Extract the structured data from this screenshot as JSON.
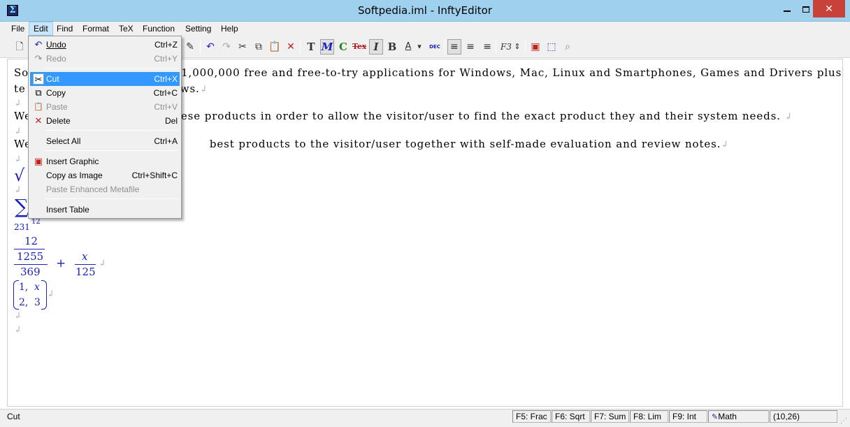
{
  "window": {
    "title": "Softpedia.iml - InftyEditor",
    "icon": "infty-editor-logo-icon",
    "app_icon_glyph": "Σ",
    "close_glyph": "✕"
  },
  "menubar": [
    "File",
    "Edit",
    "Find",
    "Format",
    "TeX",
    "Function",
    "Setting",
    "Help"
  ],
  "edit_menu": [
    {
      "label": "Undo",
      "shortcut": "Ctrl+Z",
      "icon": "↶"
    },
    {
      "label": "Redo",
      "shortcut": "Ctrl+Y",
      "icon": "↷"
    },
    {
      "label": "Cut",
      "shortcut": "Ctrl+X",
      "icon": "✂"
    },
    {
      "label": "Copy",
      "shortcut": "Ctrl+C",
      "icon": "⧉"
    },
    {
      "label": "Paste",
      "shortcut": "Ctrl+V",
      "icon": "📋"
    },
    {
      "label": "Delete",
      "shortcut": "Del",
      "icon": "✕"
    },
    {
      "label": "Select All",
      "shortcut": "Ctrl+A",
      "icon": ""
    },
    {
      "label": "Insert Graphic",
      "shortcut": "",
      "icon": "▣"
    },
    {
      "label": "Copy as Image",
      "shortcut": "Ctrl+Shift+C",
      "icon": ""
    },
    {
      "label": "Paste Enhanced Metafile",
      "shortcut": "",
      "icon": ""
    },
    {
      "label": "Insert Table",
      "shortcut": "",
      "icon": ""
    }
  ],
  "toolbar": {
    "icons": [
      "new-file-icon",
      "edit-graphic-icon",
      "undo-icon",
      "redo-icon",
      "cut-icon",
      "copy-icon",
      "paste-icon",
      "delete-icon",
      "text-mode-icon",
      "math-mode-icon",
      "chemistry-mode-icon",
      "tex-mode-icon",
      "italic-icon",
      "bold-icon",
      "font-color-icon",
      "font-color-dropdown-icon",
      "dec-icon",
      "align-left-icon",
      "align-center-icon",
      "align-right-icon",
      "function-key-icon",
      "spin-icon",
      "insert-graphic-icon",
      "copy-image-icon",
      "zoom-icon"
    ],
    "glyphs": {
      "text": "T",
      "math": "M",
      "chem": "C",
      "tex": "Tex",
      "italic": "I",
      "bold": "B",
      "font_color": "A",
      "dropdown": "▾",
      "dec": "DEC",
      "align_left": "≡",
      "align_center": "≡",
      "align_right": "≡",
      "function": "F3",
      "spin": "⇕",
      "graphic": "▣",
      "copy_image": "⬚",
      "zoom": "⌕",
      "new": "🗋",
      "edit_graphic": "✎",
      "undo": "↶",
      "redo": "↷",
      "cut": "✂",
      "copy": "⧉",
      "paste": "📋",
      "delete": "✕"
    }
  },
  "document": {
    "paragraph_mark": "↲",
    "lines": [
      {
        "pre": "So",
        "post": "1,000,000 free and free-to-try applications for Windows, Mac, Linux and Smartphones, Games and Drivers plus"
      },
      {
        "pre": " te",
        "post": "ws."
      },
      {
        "pre": "We",
        "post": "ese products in order to allow the visitor/user to find the exact product they and their system needs."
      },
      {
        "pre": "We",
        "post": "best products to the visitor/user together with self-made evaluation and review notes."
      }
    ],
    "math": {
      "sqrt_symbol": "√",
      "sum_symbol": "∑",
      "sum_lower": "231",
      "sum_upper": "12",
      "frac_num_top": "12",
      "frac_num_bottom": "1255",
      "frac_den": "369",
      "plus": "+",
      "frac2_num": "x",
      "frac2_den": "125",
      "matrix": [
        [
          "1,",
          "x"
        ],
        [
          "2,",
          "3"
        ]
      ]
    }
  },
  "statusbar": {
    "text": "Cut",
    "panels": [
      "F5:  Frac",
      "F6:  Sqrt",
      "F7:  Sum",
      "F8:  Lim",
      "F9:  Int",
      "Math",
      "(10,26)"
    ]
  }
}
